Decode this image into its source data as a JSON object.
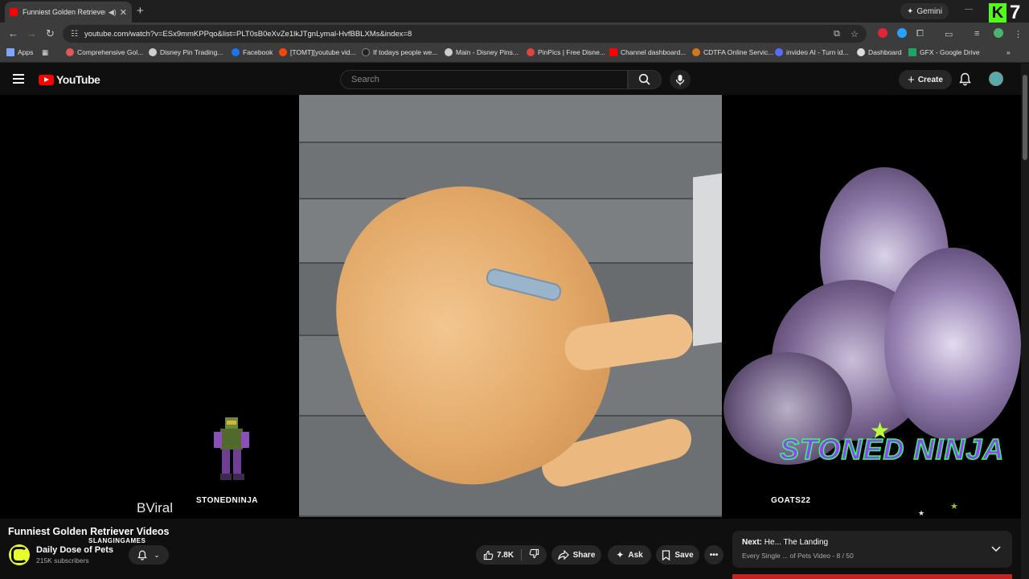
{
  "browser": {
    "tab_title": "Funniest Golden Retriever Videos",
    "new_tab": "+",
    "gemini_label": "Gemini",
    "url": "youtube.com/watch?v=ESx9mmKPPqo&list=PLT0sB0eXvZe1lkJTgnLymal-HvfBBLXMs&index=8",
    "bookmarks": [
      {
        "label": "Apps",
        "color": "#7fa7ff"
      },
      {
        "label": "Comprehensive Gol...",
        "color": "#e05858"
      },
      {
        "label": "Disney Pin Trading...",
        "color": "#cfcfcf"
      },
      {
        "label": "Facebook",
        "color": "#1877f2"
      },
      {
        "label": "[TOMT][youtube vid...",
        "color": "#ff4500"
      },
      {
        "label": "If todays people we...",
        "color": "#222222"
      },
      {
        "label": "Main - Disney Pins...",
        "color": "#cccccc"
      },
      {
        "label": "PinPics | Free Disne...",
        "color": "#e0443a"
      },
      {
        "label": "Channel dashboard...",
        "color": "#ff0000"
      },
      {
        "label": "CDTFA Online Servic...",
        "color": "#d4771c"
      },
      {
        "label": "invideo AI - Turn id...",
        "color": "#5a6cff"
      },
      {
        "label": "Dashboard",
        "color": "#dddddd"
      },
      {
        "label": "GFX - Google Drive",
        "color": "#1fa463"
      }
    ],
    "kick_letter": "K",
    "kick_number": "7"
  },
  "youtube": {
    "logo_text": "YouTube",
    "search_placeholder": "Search",
    "create_label": "Create"
  },
  "overlays": {
    "bviral": "BViral",
    "stonedninja_small": "STONEDNINJA",
    "stoned_ninja_big": "STONED NINJA",
    "goats22": "GOATS22",
    "slanging": "SLANGINGAMES"
  },
  "video": {
    "title": "Funniest Golden Retriever Videos",
    "channel": "Daily Dose of Pets",
    "subscribers": "215K subscribers",
    "likes": "7.8K",
    "share_label": "Share",
    "ask_label": "Ask",
    "save_label": "Save"
  },
  "playlist_next": {
    "prefix": "Next:",
    "title": "He... The Landing",
    "subtitle": "Every Single ... of Pets Video - 8 / 50"
  },
  "colors": {
    "yt_red": "#ff0000",
    "accent_green": "#53fc18",
    "ninja_purple": "#9b3cff"
  }
}
